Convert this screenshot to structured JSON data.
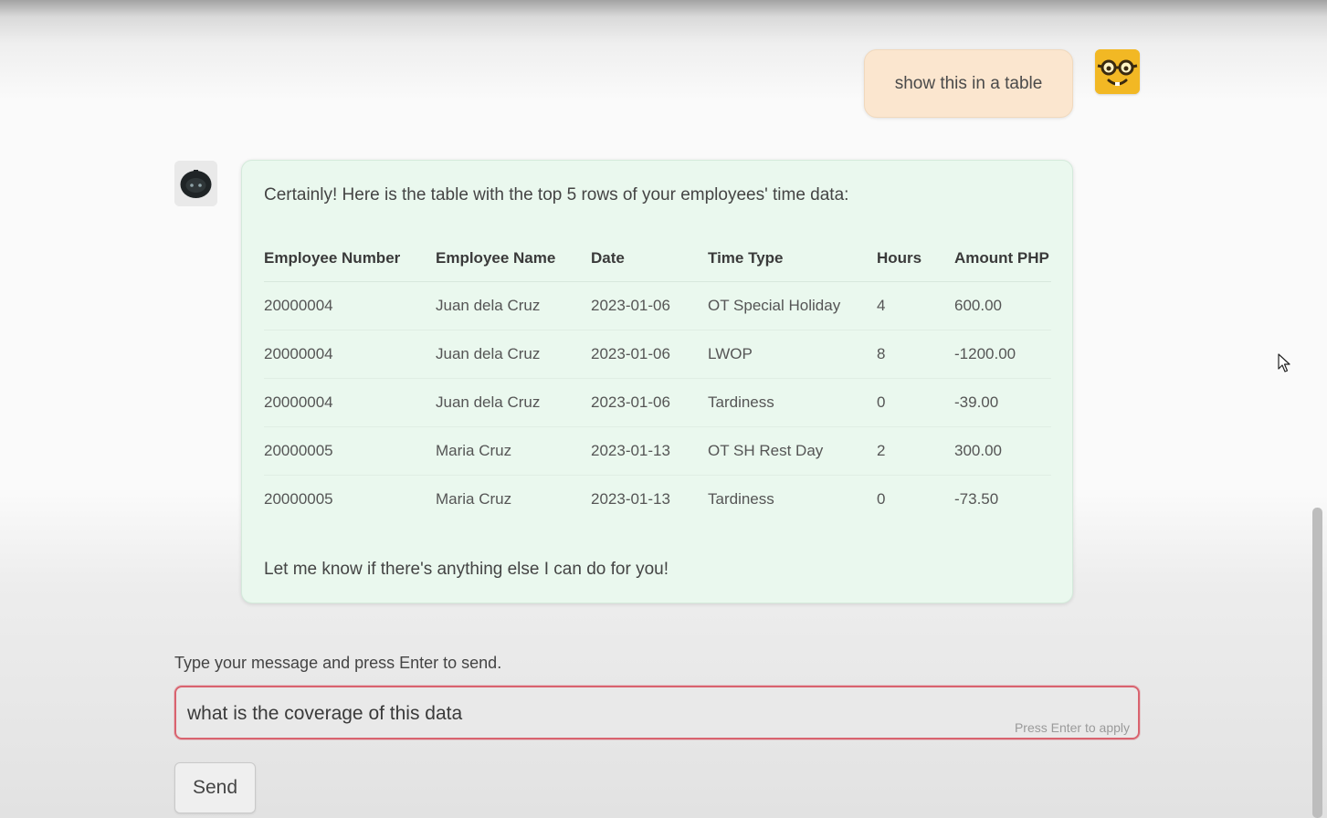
{
  "user_message": {
    "text": "show this in a table",
    "avatar_icon": "nerd-face-icon",
    "bubble_color": "#fbe6cf"
  },
  "bot_message": {
    "avatar_icon": "robot-icon",
    "bubble_color": "#eaf8ee",
    "intro": "Certainly! Here is the table with the top 5 rows of your employees' time data:",
    "outro": "Let me know if there's anything else I can do for you!",
    "table": {
      "headers": [
        "Employee Number",
        "Employee Name",
        "Date",
        "Time Type",
        "Hours",
        "Amount PHP"
      ],
      "rows": [
        [
          "20000004",
          "Juan dela Cruz",
          "2023-01-06",
          "OT Special Holiday",
          "4",
          "600.00"
        ],
        [
          "20000004",
          "Juan dela Cruz",
          "2023-01-06",
          "LWOP",
          "8",
          "-1200.00"
        ],
        [
          "20000004",
          "Juan dela Cruz",
          "2023-01-06",
          "Tardiness",
          "0",
          "-39.00"
        ],
        [
          "20000005",
          "Maria Cruz",
          "2023-01-13",
          "OT SH Rest Day",
          "2",
          "300.00"
        ],
        [
          "20000005",
          "Maria Cruz",
          "2023-01-13",
          "Tardiness",
          "0",
          "-73.50"
        ]
      ]
    }
  },
  "composer": {
    "label": "Type your message and press Enter to send.",
    "value": "what is the coverage of this data",
    "hint": "Press Enter to apply",
    "border_color": "#d9636f",
    "send_label": "Send"
  }
}
